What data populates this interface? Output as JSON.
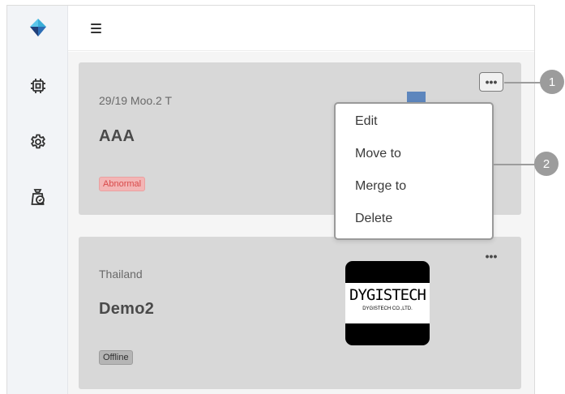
{
  "header": {
    "menu_icon": "hamburger-icon"
  },
  "sidebar": {
    "logo_icon": "diamond-logo-icon",
    "items": [
      {
        "icon": "chip-icon"
      },
      {
        "icon": "gear-icon"
      },
      {
        "icon": "shield-bag-icon"
      }
    ]
  },
  "cards": [
    {
      "address": "29/19 Moo.2 T",
      "name": "AAA",
      "status": "Abnormal",
      "more_icon": "more-dots-icon"
    },
    {
      "address": "Thailand",
      "name": "Demo2",
      "status": "Offline",
      "more_icon": "more-dots-icon",
      "logo": {
        "main": "DYGISTECH",
        "sub": "DYGISTECH CO.,LTD."
      }
    }
  ],
  "context_menu": {
    "items": [
      "Edit",
      "Move to",
      "Merge to",
      "Delete"
    ]
  },
  "callouts": [
    "1",
    "2"
  ],
  "colors": {
    "abnormal": "#d94a4a",
    "accent_blue": "#5d86bd",
    "logo_cyan": "#3aaed8",
    "logo_navy": "#1f3f7a"
  }
}
